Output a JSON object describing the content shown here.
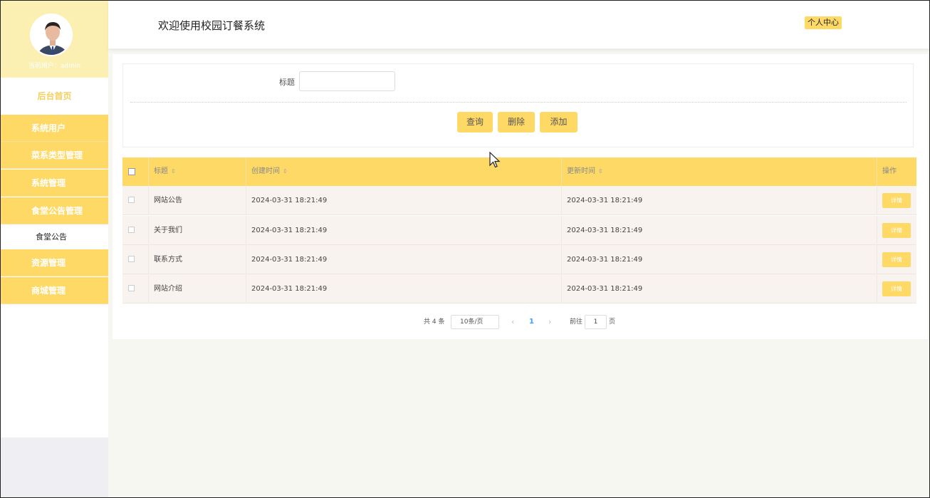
{
  "sidebar": {
    "current_user": "当前用户：admin",
    "home": "后台首页",
    "items": [
      {
        "label": "系统用户"
      },
      {
        "label": "菜系类型管理"
      },
      {
        "label": "系统管理"
      },
      {
        "label": "食堂公告管理"
      },
      {
        "label": "资源管理"
      },
      {
        "label": "商城管理"
      }
    ],
    "sub_item": "食堂公告"
  },
  "header": {
    "title": "欢迎使用校园订餐系统",
    "personal_center": "个人中心"
  },
  "search": {
    "label": "标题",
    "value": "",
    "buttons": {
      "query": "查询",
      "delete": "删除",
      "add": "添加"
    }
  },
  "table": {
    "columns": [
      "标题",
      "创建时间",
      "更新时间",
      "操作"
    ],
    "rows": [
      {
        "title": "网站公告",
        "created": "2024-03-31 18:21:49",
        "updated": "2024-03-31 18:21:49",
        "action": "详情"
      },
      {
        "title": "关于我们",
        "created": "2024-03-31 18:21:49",
        "updated": "2024-03-31 18:21:49",
        "action": "详情"
      },
      {
        "title": "联系方式",
        "created": "2024-03-31 18:21:49",
        "updated": "2024-03-31 18:21:49",
        "action": "详情"
      },
      {
        "title": "网站介绍",
        "created": "2024-03-31 18:21:49",
        "updated": "2024-03-31 18:21:49",
        "action": "详情"
      }
    ]
  },
  "pagination": {
    "total": "共 4 条",
    "page_size": "10条/页",
    "current_page": "1",
    "goto_label": "前往",
    "goto_value": "1",
    "page_unit": "页",
    "prev": "‹",
    "next": "›"
  },
  "colors": {
    "accent": "#fed966",
    "accent_light": "#fbefb2",
    "row_bg": "#f8f3ee",
    "active_page": "#409eff"
  }
}
